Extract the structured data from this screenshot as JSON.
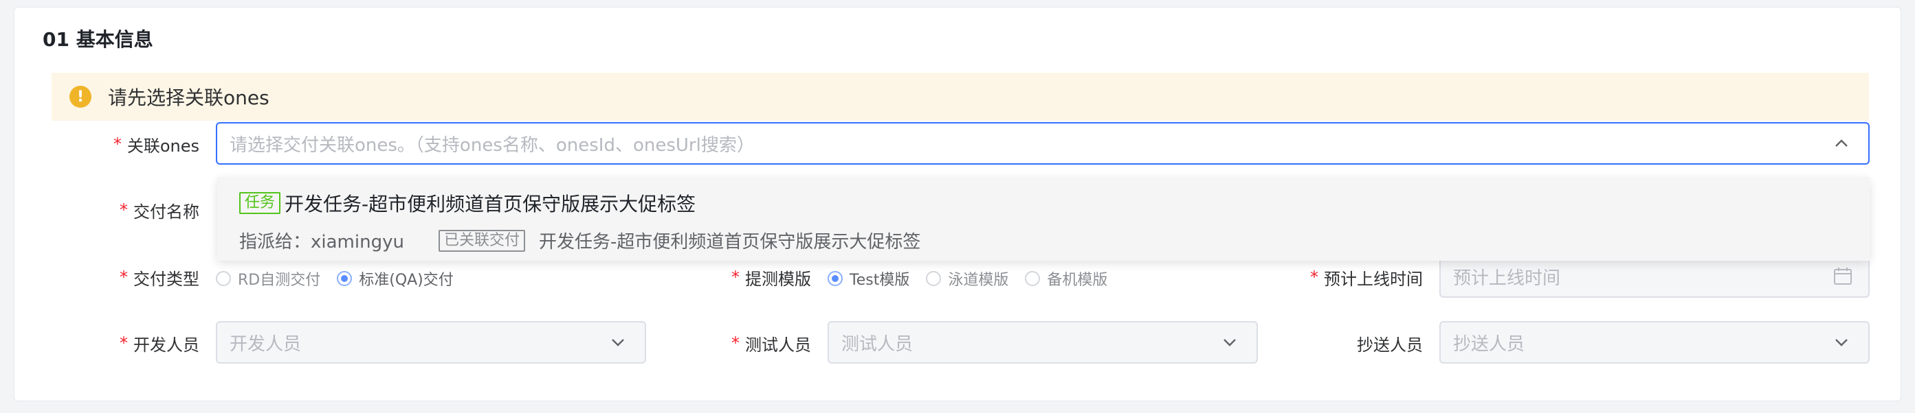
{
  "section": {
    "title": "01 基本信息"
  },
  "alert": {
    "icon": "warning-circle-icon",
    "icon_glyph": "!",
    "text": "请先选择关联ones"
  },
  "fields": {
    "ones": {
      "label": "关联ones",
      "required": "*",
      "placeholder": "请选择交付关联ones。（支持ones名称、onesId、onesUrl搜索）",
      "icon": "chevron-up-icon"
    },
    "delivery_name": {
      "label": "交付名称",
      "required": "*"
    },
    "delivery_type": {
      "label": "交付类型",
      "required": "*",
      "options": [
        "RD自测交付",
        "标准(QA)交付"
      ],
      "selected": "标准(QA)交付"
    },
    "test_template": {
      "label": "提测模版",
      "required": "*",
      "options": [
        "Test模版",
        "泳道模版",
        "备机模版"
      ],
      "selected": "Test模版"
    },
    "launch_time": {
      "label": "预计上线时间",
      "required": "*",
      "placeholder": "预计上线时间",
      "icon": "calendar-icon"
    },
    "developer": {
      "label": "开发人员",
      "required": "*",
      "placeholder": "开发人员",
      "icon": "chevron-down-icon"
    },
    "tester": {
      "label": "测试人员",
      "required": "*",
      "placeholder": "测试人员",
      "icon": "chevron-down-icon"
    },
    "cc": {
      "label": "抄送人员",
      "placeholder": "抄送人员",
      "icon": "chevron-down-icon"
    }
  },
  "dropdown": {
    "option": {
      "tag": "任务",
      "title": "开发任务-超市便利频道首页保守版展示大促标签",
      "assignee": "指派给：xiamingyu",
      "linked_tag": "已关联交付",
      "linked_title": "开发任务-超市便利频道首页保守版展示大促标签"
    }
  },
  "colors": {
    "primary": "#3370ff",
    "required": "#f5222d",
    "warning": "#f0b429",
    "success": "#52c41a"
  }
}
